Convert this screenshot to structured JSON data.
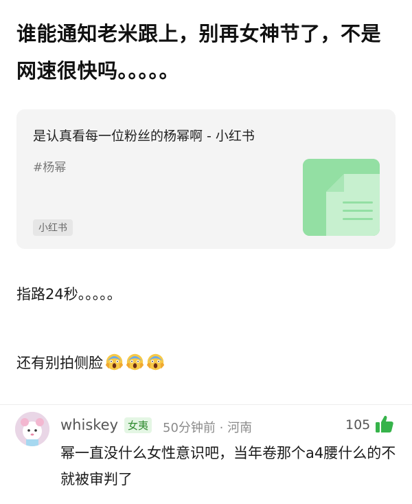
{
  "post": {
    "title": "谁能通知老米跟上，别再女神节了，不是网速很快吗。。。。。"
  },
  "share_card": {
    "title": "是认真看每一位粉丝的杨幂啊 - 小红书",
    "tag": "#杨幂",
    "source": "小红书",
    "thumb_color": "#93dfa3"
  },
  "body": {
    "line1": "指路24秒。。。。。",
    "line2": "还有别拍侧脸",
    "emoji": "scream-emoji"
  },
  "comment": {
    "username": "whiskey",
    "badge": "女夷",
    "time_location": "50分钟前 · 河南",
    "likes": "105",
    "text": "幂一直没什么女性意识吧，当年卷那个a4腰什么的不就被审判了",
    "accent": "#36b34a"
  }
}
